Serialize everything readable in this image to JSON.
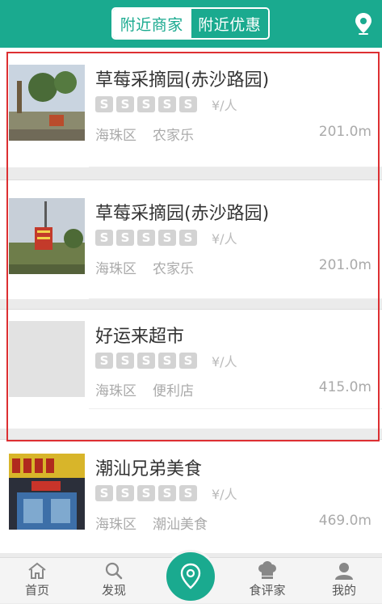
{
  "header": {
    "tabs": [
      {
        "label": "附近商家",
        "active": true
      },
      {
        "label": "附近优惠",
        "active": false
      }
    ],
    "icon": "location-pin-icon",
    "accent": "#1aaa8f"
  },
  "rating_glyph": "S",
  "stores": [
    {
      "name": "草莓采摘园(赤沙路园)",
      "price": "¥/人",
      "district": "海珠区",
      "category": "农家乐",
      "distance": "201.0m"
    },
    {
      "name": "草莓采摘园(赤沙路园)",
      "price": "¥/人",
      "district": "海珠区",
      "category": "农家乐",
      "distance": "201.0m"
    },
    {
      "name": "好运来超市",
      "price": "¥/人",
      "district": "海珠区",
      "category": "便利店",
      "distance": "415.0m"
    },
    {
      "name": "潮汕兄弟美食",
      "price": "¥/人",
      "district": "海珠区",
      "category": "潮汕美食",
      "distance": "469.0m"
    }
  ],
  "tabbar": {
    "items": [
      {
        "label": "首页",
        "icon": "home-icon"
      },
      {
        "label": "发现",
        "icon": "search-icon"
      },
      {
        "label": "",
        "icon": "location-pin-icon"
      },
      {
        "label": "食评家",
        "icon": "chef-hat-icon"
      },
      {
        "label": "我的",
        "icon": "user-icon"
      }
    ]
  }
}
